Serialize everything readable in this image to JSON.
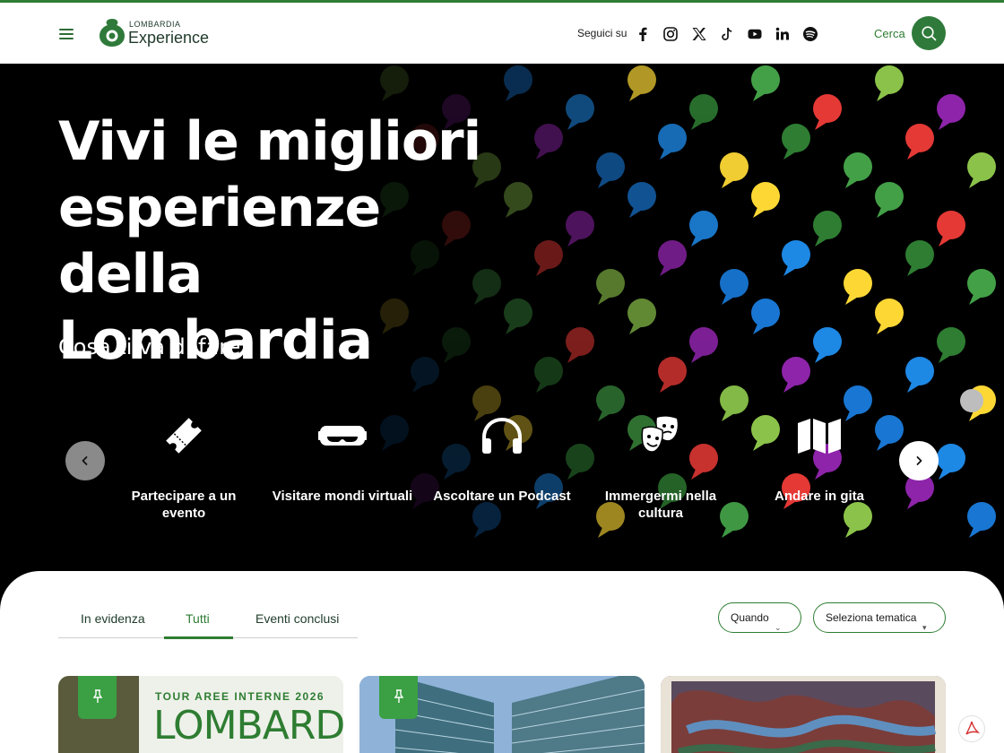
{
  "header": {
    "logo_small": "LOMBARDIA",
    "logo_big": "Experience",
    "follow_label": "Seguici su",
    "social_icons": [
      "facebook-icon",
      "instagram-icon",
      "x-icon",
      "tiktok-icon",
      "youtube-icon",
      "linkedin-icon",
      "spotify-icon"
    ],
    "search_label": "Cerca"
  },
  "hero": {
    "title": "Vivi le migliori esperienze della Lombardia",
    "subtitle": "Cosa ti va di fare?",
    "categories": [
      {
        "label": "Partecipare a un evento",
        "icon": "ticket-icon"
      },
      {
        "label": "Visitare mondi virtuali",
        "icon": "vr-headset-icon"
      },
      {
        "label": "Ascoltare un Podcast",
        "icon": "headphones-icon"
      },
      {
        "label": "Immergermi nella cultura",
        "icon": "theater-masks-icon"
      },
      {
        "label": "Andare in gita",
        "icon": "map-icon"
      }
    ]
  },
  "filters": {
    "tabs": [
      "In evidenza",
      "Tutti",
      "Eventi conclusi"
    ],
    "active_tab": "Tutti",
    "when_label": "Quando",
    "theme_label": "Seleziona tematica"
  },
  "cards": [
    {
      "line1": "TOUR AREE INTERNE 2026",
      "line2": "LOMBARDIA"
    }
  ],
  "colors": {
    "brand_green": "#2e7d32",
    "hero_bg": "#000000"
  }
}
